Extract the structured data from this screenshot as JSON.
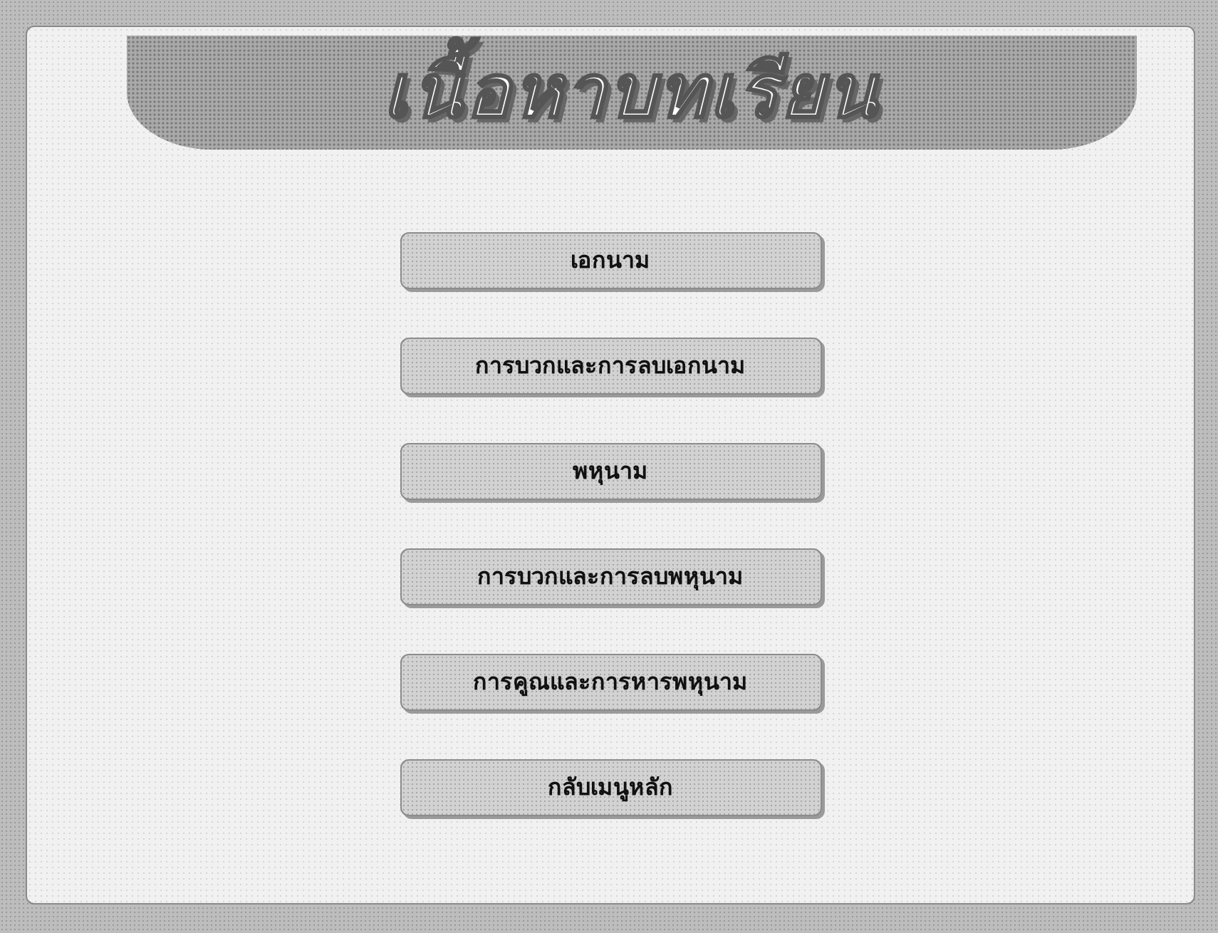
{
  "title": "เนื้อหาบทเรียน",
  "buttons": [
    {
      "label": "เอกนาม"
    },
    {
      "label": "การบวกและการลบเอกนาม"
    },
    {
      "label": "พหุนาม"
    },
    {
      "label": "การบวกและการลบพหุนาม"
    },
    {
      "label": "การคูณและการหารพหุนาม"
    },
    {
      "label": "กลับเมนูหลัก"
    }
  ]
}
